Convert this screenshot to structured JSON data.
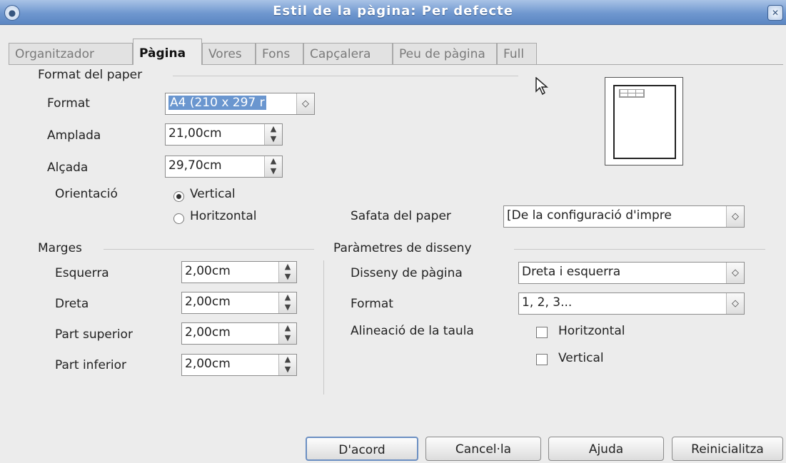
{
  "window": {
    "title": "Estil de la pàgina: Per defecte"
  },
  "tabs": [
    "Organitzador",
    "Pàgina",
    "Vores",
    "Fons",
    "Capçalera",
    "Peu de pàgina",
    "Full"
  ],
  "paper_format": {
    "group_label": "Format del paper",
    "format_label": "Format",
    "format_value": "A4 (210 x 297 r",
    "width_label": "Amplada",
    "width_value": "21,00cm",
    "height_label": "Alçada",
    "height_value": "29,70cm",
    "orientation_label": "Orientació",
    "orientation_options": [
      "Vertical",
      "Horitzontal"
    ],
    "orientation_selected": "Vertical",
    "tray_label": "Safata del paper",
    "tray_value": "[De la configuració d'impre"
  },
  "margins": {
    "group_label": "Marges",
    "left_label": "Esquerra",
    "left_value": "2,00cm",
    "right_label": "Dreta",
    "right_value": "2,00cm",
    "top_label": "Part superior",
    "top_value": "2,00cm",
    "bottom_label": "Part inferior",
    "bottom_value": "2,00cm"
  },
  "layout_settings": {
    "group_label": "Paràmetres de disseny",
    "page_layout_label": "Disseny de pàgina",
    "page_layout_value": "Dreta i esquerra",
    "format_label": "Format",
    "format_value": "1, 2, 3...",
    "table_alignment_label": "Alineació de la taula",
    "horizontal_label": "Horitzontal",
    "vertical_label": "Vertical"
  },
  "buttons": {
    "ok": "D'acord",
    "cancel": "Cancel·la",
    "help": "Ajuda",
    "reset": "Reinicialitza"
  },
  "icons": {
    "window_menu": "circle-menu-icon",
    "close": "close-icon",
    "spin": "spin-arrows-icon",
    "cursor": "mouse-pointer-icon"
  }
}
